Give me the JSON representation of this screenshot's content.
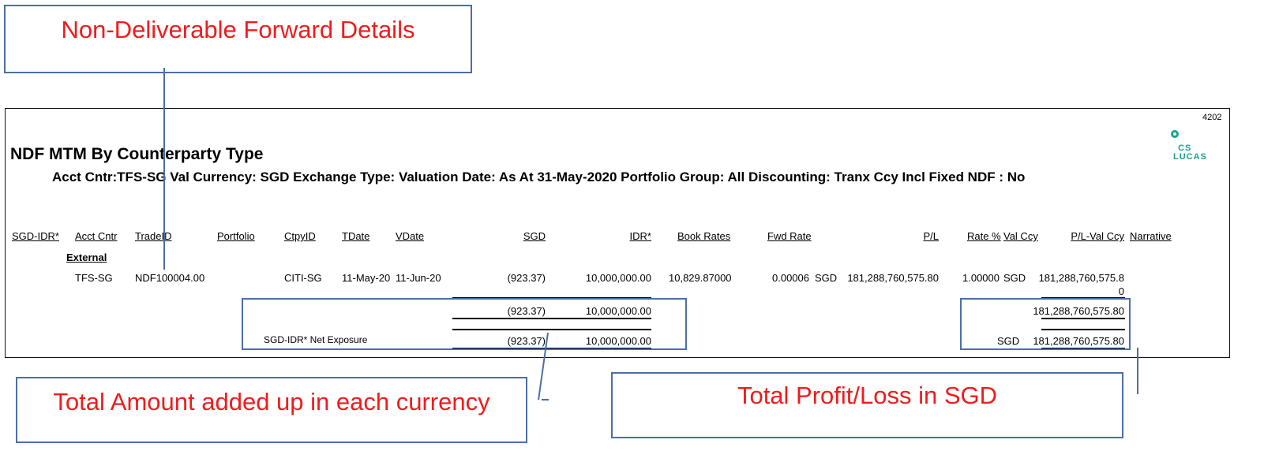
{
  "callouts": {
    "ndf_details": "Non-Deliverable Forward Details",
    "total_amount": "Total Amount added up in each currency",
    "total_pl": "Total Profit/Loss in SGD"
  },
  "report": {
    "page_number": "4202",
    "logo_line1": "CS",
    "logo_line2": "LUCAS",
    "title": "NDF MTM By Counterparty Type",
    "subtitle": "Acct Cntr:TFS-SG Val Currency: SGD Exchange Type: Valuation Date: As At  31-May-2020 Portfolio Group: All  Discounting: Tranx Ccy  Incl Fixed NDF : No",
    "headers": {
      "sgd_idr": "SGD-IDR*",
      "acct_cntr": "Acct Cntr",
      "trade_id": "TradeID",
      "portfolio": "Portfolio",
      "ctpy_id": "CtpyID",
      "tdate": "TDate",
      "vdate": "VDate",
      "sgd": "SGD",
      "idr": "IDR*",
      "book_rates": "Book Rates",
      "fwd_rate": "Fwd Rate",
      "pl": "P/L",
      "rate_pct": "Rate %",
      "val_ccy": "Val Ccy",
      "pl_val_ccy": "P/L-Val Ccy",
      "narrative": "Narrative"
    },
    "group_label": "External",
    "row": {
      "acct_cntr": "TFS-SG",
      "trade_id": "NDF100004.00",
      "ctpy_id": "CITI-SG",
      "tdate": "11-May-20",
      "vdate": "11-Jun-20",
      "sgd": "(923.37)",
      "idr": "10,000,000.00",
      "book_rates": "10,829.87000",
      "fwd_rate": "0.00006",
      "fwd_ccy": "SGD",
      "pl": "181,288,760,575.80",
      "rate_pct": "1.00000",
      "val_ccy": "SGD",
      "pl_val_ccy_line1": "181,288,760,575.8",
      "pl_val_ccy_line2": "0"
    },
    "subtotal": {
      "sgd": "(923.37)",
      "idr": "10,000,000.00",
      "pl_val_ccy": "181,288,760,575.80"
    },
    "net": {
      "label": "SGD-IDR* Net Exposure",
      "sgd": "(923.37)",
      "idr": "10,000,000.00",
      "ccy": "SGD",
      "pl_val_ccy": "181,288,760,575.80"
    }
  }
}
